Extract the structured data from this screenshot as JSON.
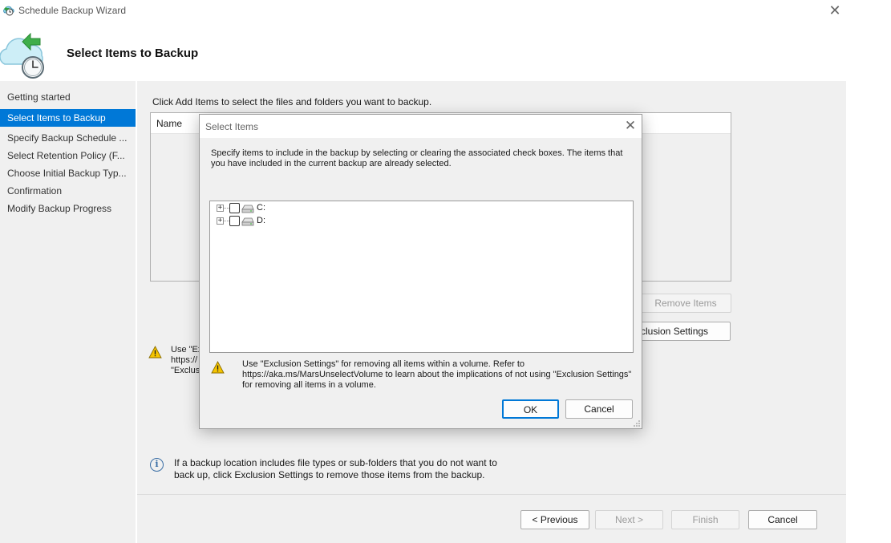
{
  "window": {
    "title": "Schedule Backup Wizard",
    "close_glyph": "✕"
  },
  "header": {
    "page_title": "Select Items to Backup"
  },
  "sidebar": {
    "items": [
      {
        "label": "Getting started"
      },
      {
        "label": "Select Items to Backup"
      },
      {
        "label": "Specify Backup Schedule ..."
      },
      {
        "label": "Select Retention Policy (F..."
      },
      {
        "label": "Choose Initial Backup Typ..."
      },
      {
        "label": "Confirmation"
      },
      {
        "label": "Modify Backup Progress"
      }
    ],
    "active_index": 1
  },
  "main": {
    "instruction": "Click Add Items to select the files and folders you want to backup.",
    "list_column_name": "Name",
    "remove_items_label": "Remove Items",
    "exclusion_settings_label": "clusion Settings",
    "warning_text_line1": "Use \"Ex",
    "warning_text_line2": "https://",
    "warning_text_line3": "\"Exclus",
    "info_text": "If a backup location includes file types or sub-folders that you do not want to back up, click Exclusion Settings to remove those items from the backup.",
    "previous_label": "< Previous",
    "next_label": "Next >",
    "finish_label": "Finish",
    "cancel_label": "Cancel"
  },
  "dialog": {
    "title": "Select Items",
    "close_glyph": "✕",
    "description": "Specify items to include in the backup by selecting or clearing the associated check boxes. The items that you have included in the current backup are already selected.",
    "drives": [
      {
        "label": "C:",
        "checked": false
      },
      {
        "label": "D:",
        "checked": false
      }
    ],
    "warning_text": "Use \"Exclusion Settings\" for removing all items within a volume. Refer to https://aka.ms/MarsUnselectVolume to learn about the implications of not using \"Exclusion Settings\" for removing all items in a volume.",
    "ok_label": "OK",
    "cancel_label": "Cancel"
  },
  "icons": {
    "app": "cloud-backup-icon",
    "wizard": "cloud-clock-icon",
    "warning": "warning-icon",
    "info": "info-icon",
    "drive": "drive-icon"
  },
  "colors": {
    "accent": "#0078d7",
    "panel_bg": "#f0f0f0",
    "warning": "#f2c500"
  }
}
